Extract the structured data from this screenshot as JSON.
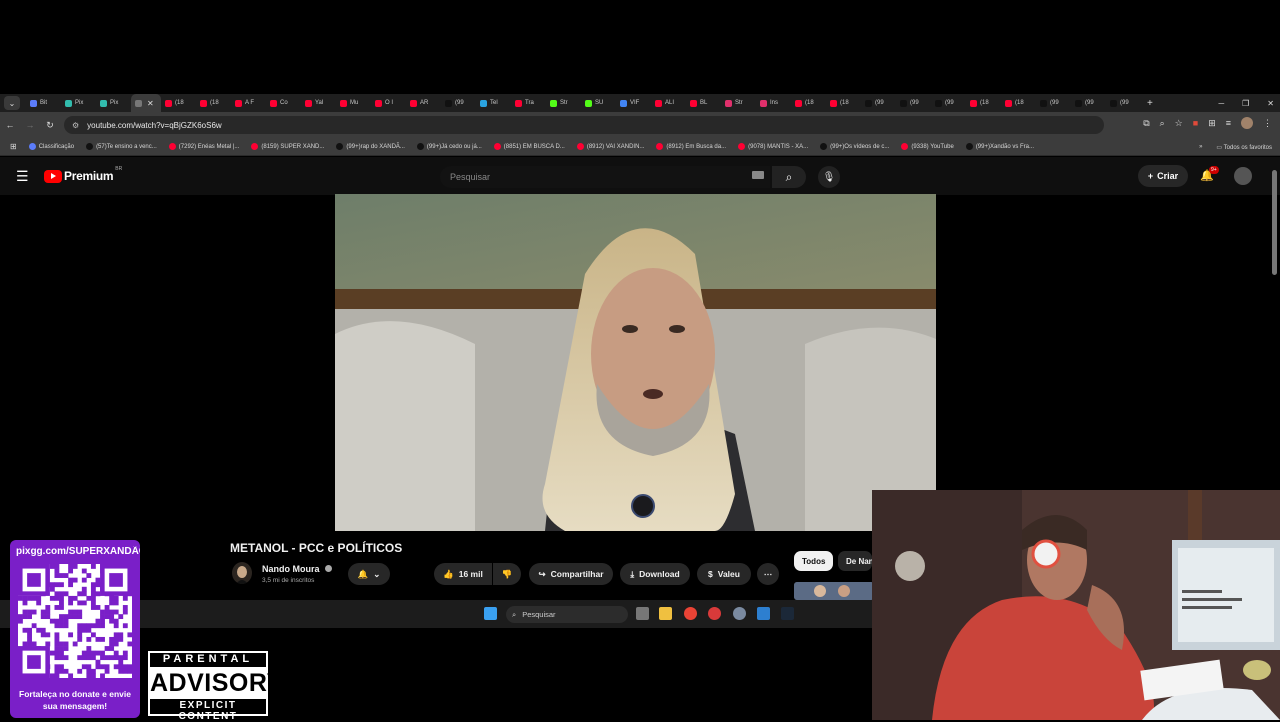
{
  "browser": {
    "tabs": [
      "Bit",
      "Pix",
      "Pix",
      "",
      "(18",
      "(18",
      "A F",
      "Co",
      "Yal",
      "Mu",
      "O I",
      "AR",
      "(99",
      "Tel",
      "Tra",
      "Str",
      "SU",
      "VIF",
      "ALI",
      "BL",
      "Str",
      "Ins",
      "(18",
      "(18",
      "(99",
      "(99",
      "(99",
      "(18",
      "(18",
      "(99",
      "(99",
      "(99"
    ],
    "tab_colors": [
      "#5b7cfa",
      "#32bcad",
      "#32bcad",
      "#777",
      "#ff0033",
      "#ff0033",
      "#ff0033",
      "#ff0033",
      "#ff0033",
      "#ff0033",
      "#ff0033",
      "#ff0033",
      "#111",
      "#2aa3e0",
      "#ff0033",
      "#53fc18",
      "#53fc18",
      "#4285f4",
      "#ff0033",
      "#ff0033",
      "#e1306c",
      "#e1306c",
      "#ff0033",
      "#ff0033",
      "#111",
      "#111",
      "#111",
      "#ff0033",
      "#ff0033",
      "#111",
      "#111",
      "#111"
    ],
    "url": "youtube.com/watch?v=qBjGZK6oS6w",
    "bookmarks": [
      {
        "label": "Classificação",
        "color": "#5b7cfa"
      },
      {
        "label": "(57)Te ensino a venc...",
        "color": "#111"
      },
      {
        "label": "(7292) Enéas Metal |...",
        "color": "#ff0033"
      },
      {
        "label": "(8159) SUPER XAND...",
        "color": "#ff0033"
      },
      {
        "label": "(99+)rap do XANDÃ...",
        "color": "#111"
      },
      {
        "label": "(99+)Já cedo ou já...",
        "color": "#111"
      },
      {
        "label": "(8851) EM BUSCA D...",
        "color": "#ff0033"
      },
      {
        "label": "(8912) VAI XANDIN...",
        "color": "#ff0033"
      },
      {
        "label": "(8912) Em Busca da...",
        "color": "#ff0033"
      },
      {
        "label": "(9078) MANTIS - XA...",
        "color": "#ff0033"
      },
      {
        "label": "(99+)Os vídeos de c...",
        "color": "#111"
      },
      {
        "label": "(9338) YouTube",
        "color": "#ff0033"
      },
      {
        "label": "(99+)Xandão vs Fra...",
        "color": "#111"
      }
    ],
    "all_bookmarks": "Todos os favoritos"
  },
  "youtube": {
    "logo_text": "Premium",
    "region": "BR",
    "search_placeholder": "Pesquisar",
    "create_label": "Criar",
    "notification_count": "9+",
    "video_title": "METANOL - PCC e POLÍTICOS",
    "channel_name": "Nando Moura",
    "subscribers": "3,5 mi de inscritos",
    "likes": "16 mil",
    "share_label": "Compartilhar",
    "download_label": "Download",
    "thanks_label": "Valeu",
    "chips": [
      "Todos",
      "De Nan"
    ]
  },
  "taskbar": {
    "search_label": "Pesquisar"
  },
  "overlay": {
    "qr_url": "pixgg.com/SUPERXANDÃO",
    "qr_caption": "Fortaleça no donate e envie sua mensagem!",
    "advisory_top": "PARENTAL",
    "advisory_mid": "ADVISORY",
    "advisory_bottom": "EXPLICIT CONTENT"
  }
}
